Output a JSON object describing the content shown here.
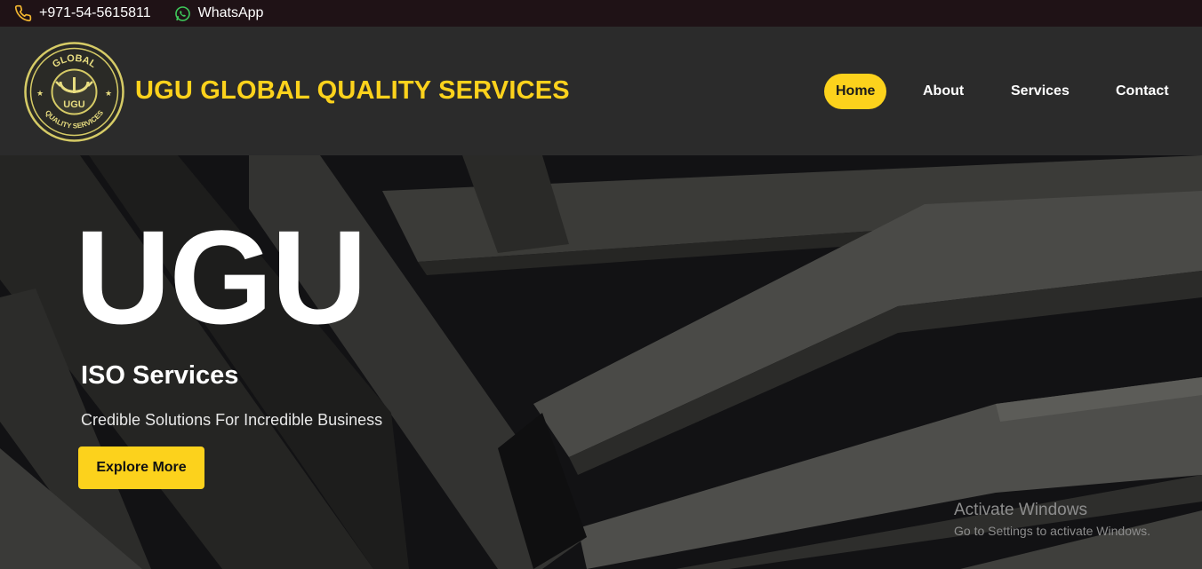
{
  "topbar": {
    "phone": "+971-54-5615811",
    "whatsapp": "WhatsApp",
    "phone_icon": "phone-icon",
    "whatsapp_icon": "whatsapp-icon"
  },
  "header": {
    "brand": "UGU GLOBAL QUALITY SERVICES",
    "logo": {
      "top_text": "GLOBAL",
      "center_text": "UGU",
      "bottom_text": "QUALITY SERVICES"
    },
    "nav": [
      {
        "label": "Home",
        "active": true
      },
      {
        "label": "About",
        "active": false
      },
      {
        "label": "Services",
        "active": false
      },
      {
        "label": "Contact",
        "active": false
      }
    ]
  },
  "hero": {
    "title": "UGU",
    "subtitle": "ISO Services",
    "tagline": "Credible Solutions For Incredible Business",
    "cta": "Explore More"
  },
  "watermark": {
    "line1": "Activate Windows",
    "line2": "Go to Settings to activate Windows."
  },
  "colors": {
    "accent": "#fcd21c",
    "topbar_bg": "#1f1216",
    "header_bg": "#2b2b2b"
  }
}
